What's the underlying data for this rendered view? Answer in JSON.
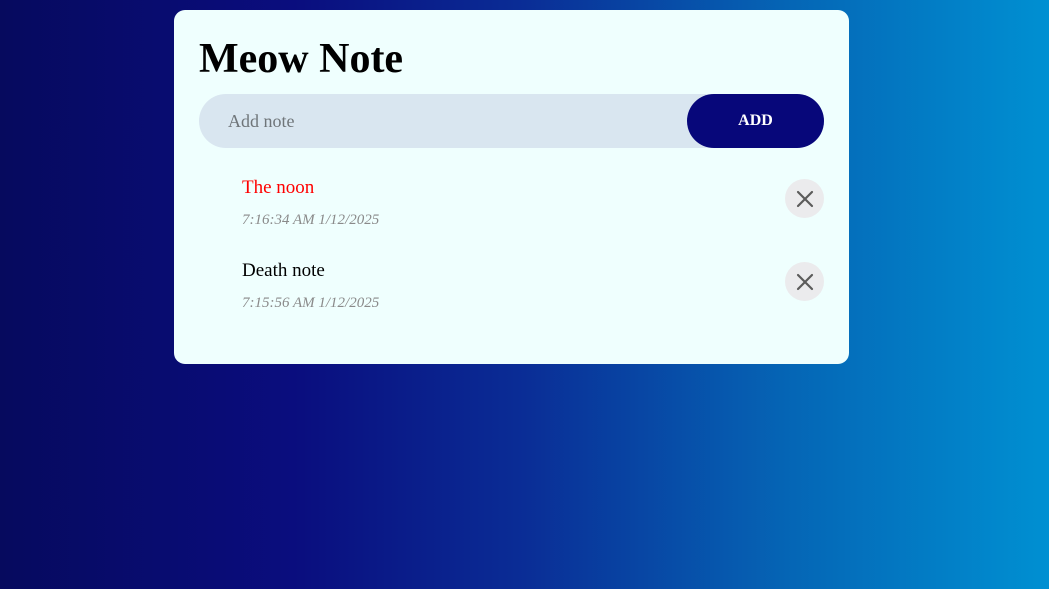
{
  "app": {
    "title": "Meow Note"
  },
  "composer": {
    "placeholder": "Add note",
    "value": "",
    "add_label": "ADD"
  },
  "notes": [
    {
      "text": "The noon",
      "timestamp": "7:16:34 AM 1/12/2025",
      "highlighted": true,
      "text_color": "#ff0000"
    },
    {
      "text": "Death note",
      "timestamp": "7:15:56 AM 1/12/2025",
      "highlighted": false,
      "text_color": "#000000"
    }
  ],
  "icons": {
    "delete": "close-icon"
  },
  "colors": {
    "accent": "#07077a",
    "card_background": "#effffe",
    "input_background": "#d9e6f0",
    "highlight_text": "#ff0000",
    "timestamp_text": "#8a8a8a",
    "background_start": "#060a5e",
    "background_end": "#0090d2"
  }
}
